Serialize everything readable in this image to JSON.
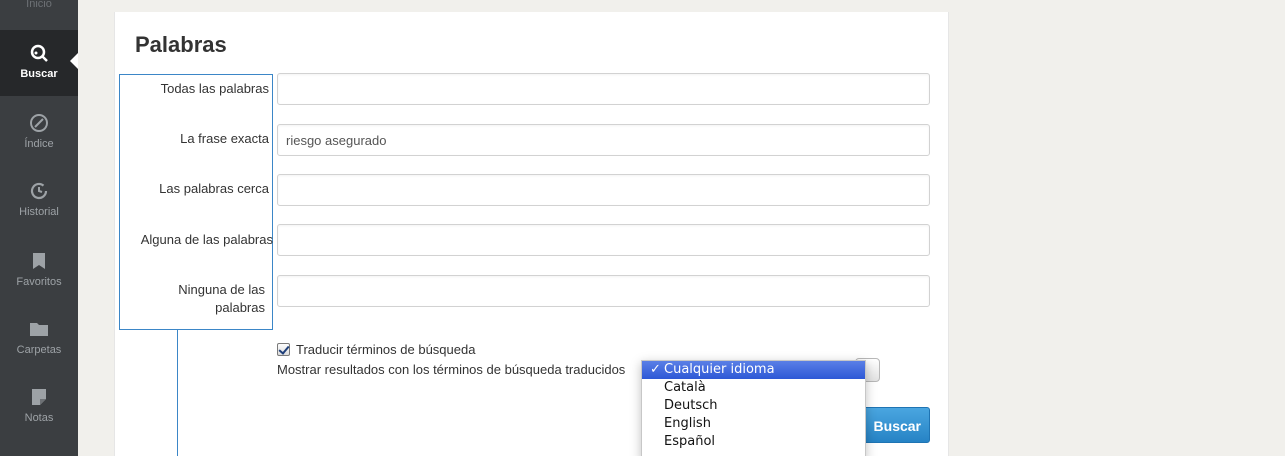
{
  "sidebar": {
    "top_partial_label": "Inicio",
    "items": [
      {
        "label": "Buscar",
        "icon": "search-icon",
        "active": true
      },
      {
        "label": "Índice",
        "icon": "compass-icon",
        "active": false
      },
      {
        "label": "Historial",
        "icon": "history-icon",
        "active": false
      },
      {
        "label": "Favoritos",
        "icon": "bookmark-icon",
        "active": false
      },
      {
        "label": "Carpetas",
        "icon": "folder-icon",
        "active": false
      },
      {
        "label": "Notas",
        "icon": "note-icon",
        "active": false
      }
    ]
  },
  "form": {
    "title": "Palabras",
    "fields": [
      {
        "label": "Todas las palabras",
        "value": ""
      },
      {
        "label": "La frase exacta",
        "value": "riesgo asegurado"
      },
      {
        "label": "Las palabras cerca",
        "value": ""
      },
      {
        "label": "Alguna de las palabras",
        "value": ""
      },
      {
        "label": "Ninguna de las palabras",
        "value": ""
      }
    ],
    "translate_checkbox_label": "Traducir términos de búsqueda",
    "translate_checked": true,
    "show_results_label": "Mostrar resultados con los términos de búsqueda traducidos",
    "search_button": "Buscar"
  },
  "language_dropdown": {
    "selected": "Cualquier idioma",
    "options": [
      "Cualquier idioma",
      "Català",
      "Deutsch",
      "English",
      "Español"
    ]
  },
  "colors": {
    "sidebar_bg": "#3b3e41",
    "accent": "#2683c5",
    "highlight": "#2d58d6"
  }
}
